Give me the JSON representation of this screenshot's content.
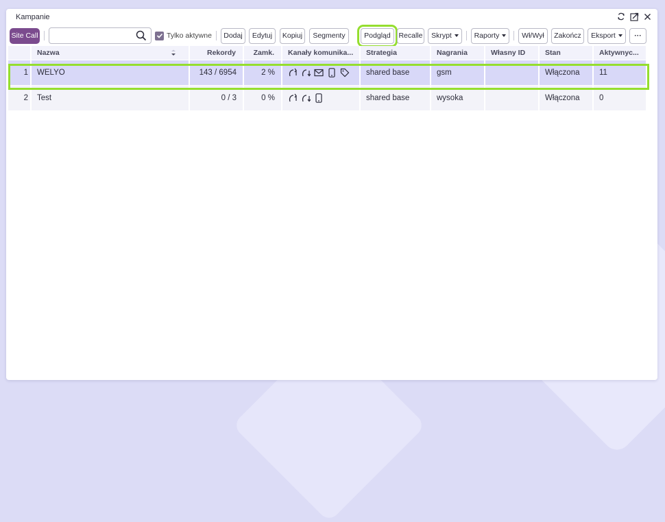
{
  "window": {
    "title": "Kampanie"
  },
  "toolbar": {
    "site_call": "Site Call",
    "search_placeholder": "",
    "only_active": "Tylko aktywne",
    "dodaj": "Dodaj",
    "edytuj": "Edytuj",
    "kopiuj": "Kopiuj",
    "segmenty": "Segmenty",
    "podglad": "Podgląd",
    "recalle": "Recalle",
    "skrypt": "Skrypt",
    "raporty": "Raporty",
    "wlwyl": "Wł/Wył",
    "zakoncz": "Zakończ",
    "eksport": "Eksport",
    "more": "···"
  },
  "columns": {
    "nazwa": "Nazwa",
    "rekordy": "Rekordy",
    "zamk": "Zamk.",
    "kanaly": "Kanały komunika...",
    "strategia": "Strategia",
    "nagrania": "Nagrania",
    "wlasny_id": "Własny ID",
    "stan": "Stan",
    "aktywnych": "Aktywnyc..."
  },
  "rows": [
    {
      "idx": "1",
      "nazwa": "WELYO",
      "rekordy": "143 / 6954",
      "zamk": "2 %",
      "channels": [
        "call-out-icon",
        "call-in-icon",
        "email-icon",
        "sms-icon",
        "tag-icon"
      ],
      "strategia": "shared base",
      "nagrania": "gsm",
      "wlasny_id": "",
      "stan": "Włączona",
      "aktywnych": "11"
    },
    {
      "idx": "2",
      "nazwa": "Test",
      "rekordy": "0 / 3",
      "zamk": "0 %",
      "channels": [
        "call-out-icon",
        "call-in-icon",
        "sms-icon"
      ],
      "strategia": "shared base",
      "nagrania": "wysoka",
      "wlasny_id": "",
      "stan": "Włączona",
      "aktywnych": "0"
    }
  ],
  "colors": {
    "accent": "#7b4b8e",
    "highlight": "#95de2f",
    "selected_row": "#d8d8f8"
  }
}
